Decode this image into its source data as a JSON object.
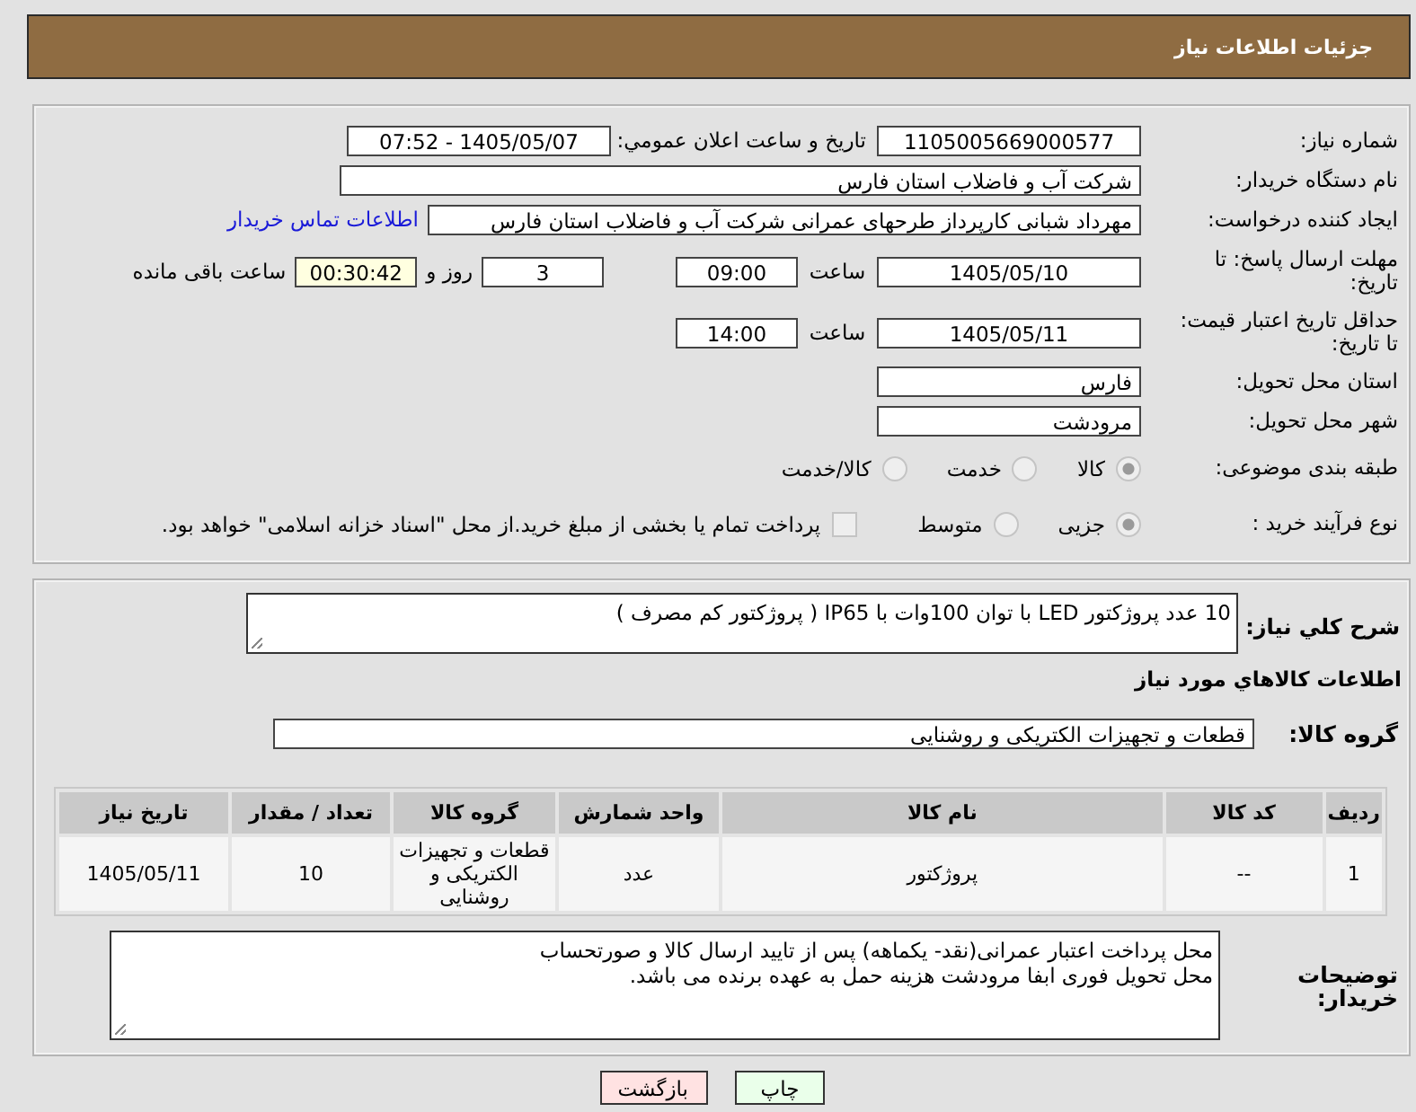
{
  "header": {
    "title": "جزئیات اطلاعات نیاز"
  },
  "details": {
    "need_number": {
      "label": "شماره نیاز:",
      "value": "1105005669000577"
    },
    "announce": {
      "label": "تاریخ و ساعت اعلان عمومي:",
      "value": "1405/05/07 - 07:52"
    },
    "buyer": {
      "label": "نام دستگاه خریدار:",
      "value": "شرکت آب و فاضلاب استان فارس"
    },
    "requester": {
      "label": "ایجاد کننده درخواست:",
      "value": "مهرداد شبانی کارپرداز طرحهای عمرانی  شرکت آب و فاضلاب استان فارس",
      "link": "اطلاعات تماس خریدار"
    },
    "deadline": {
      "label": "مهلت ارسال پاسخ: تا تاریخ:",
      "date": "1405/05/10",
      "time_label": "ساعت",
      "time": "09:00",
      "days": "3",
      "days_label": "روز و",
      "remaining": "00:30:42",
      "remaining_label": "ساعت باقی مانده"
    },
    "validity": {
      "label": "حداقل تاریخ اعتبار قیمت: تا تاریخ:",
      "date": "1405/05/11",
      "time_label": "ساعت",
      "time": "14:00"
    },
    "province": {
      "label": "استان محل تحویل:",
      "value": "فارس"
    },
    "city": {
      "label": "شهر محل تحویل:",
      "value": "مرودشت"
    },
    "category": {
      "label": "طبقه بندی موضوعی:",
      "options": [
        {
          "label": "کالا",
          "selected": true
        },
        {
          "label": "خدمت",
          "selected": false
        },
        {
          "label": "کالا/خدمت",
          "selected": false
        }
      ]
    },
    "process": {
      "label": "نوع فرآیند خرید :",
      "options": [
        {
          "label": "جزیی",
          "selected": true
        },
        {
          "label": "متوسط",
          "selected": false
        }
      ],
      "payment": {
        "label": "پرداخت تمام یا بخشی از مبلغ خرید.از محل \"اسناد خزانه اسلامی\" خواهد بود.",
        "checked": false
      }
    }
  },
  "description": {
    "label": "شرح کلي نیاز:",
    "value": "10 عدد پروژکتور LED با توان 100وات با IP65 ( پروژکتور کم مصرف )"
  },
  "goods": {
    "title": "اطلاعات کالاهاي مورد نیاز",
    "group_label": "گروه کالا:",
    "group_value": "قطعات و تجهیزات الکتریکی و روشنایی",
    "table": {
      "columns": [
        "ردیف",
        "کد کالا",
        "نام کالا",
        "واحد شمارش",
        "گروه کالا",
        "تعداد / مقدار",
        "تاریخ نیاز"
      ],
      "rows": [
        [
          "1",
          "--",
          "پروژکتور",
          "عدد",
          "قطعات و تجهیزات الکتریکی و روشنایی",
          "10",
          "1405/05/11"
        ]
      ]
    }
  },
  "buyer_notes": {
    "label": "توضیحات خریدار:",
    "lines": [
      "محل پرداخت اعتبار عمرانی(نقد- یکماهه) پس از تایید ارسال کالا و صورتحساب",
      "محل تحویل فوری ابفا مرودشت هزینه حمل به عهده برنده می باشد."
    ]
  },
  "buttons": [
    {
      "label": "چاپ",
      "kind": "print"
    },
    {
      "label": "بازگشت",
      "kind": "back"
    }
  ]
}
